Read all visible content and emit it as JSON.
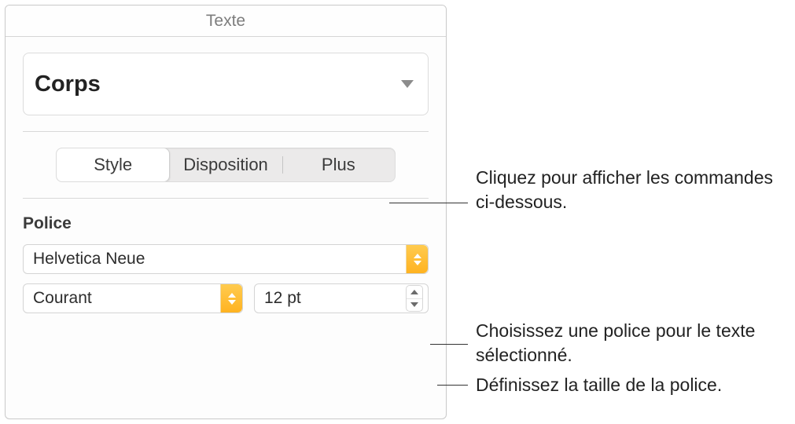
{
  "panel": {
    "title": "Texte"
  },
  "paragraph_style": {
    "current": "Corps"
  },
  "tabs": {
    "style": "Style",
    "disposition": "Disposition",
    "plus": "Plus"
  },
  "font_section": {
    "label": "Police",
    "family": "Helvetica Neue",
    "typeface": "Courant",
    "size": "12 pt"
  },
  "callouts": {
    "tabs": "Cliquez pour afficher les commandes ci-dessous.",
    "family": "Choisissez une police pour le texte sélectionné.",
    "size": "Définissez la taille de la police."
  }
}
